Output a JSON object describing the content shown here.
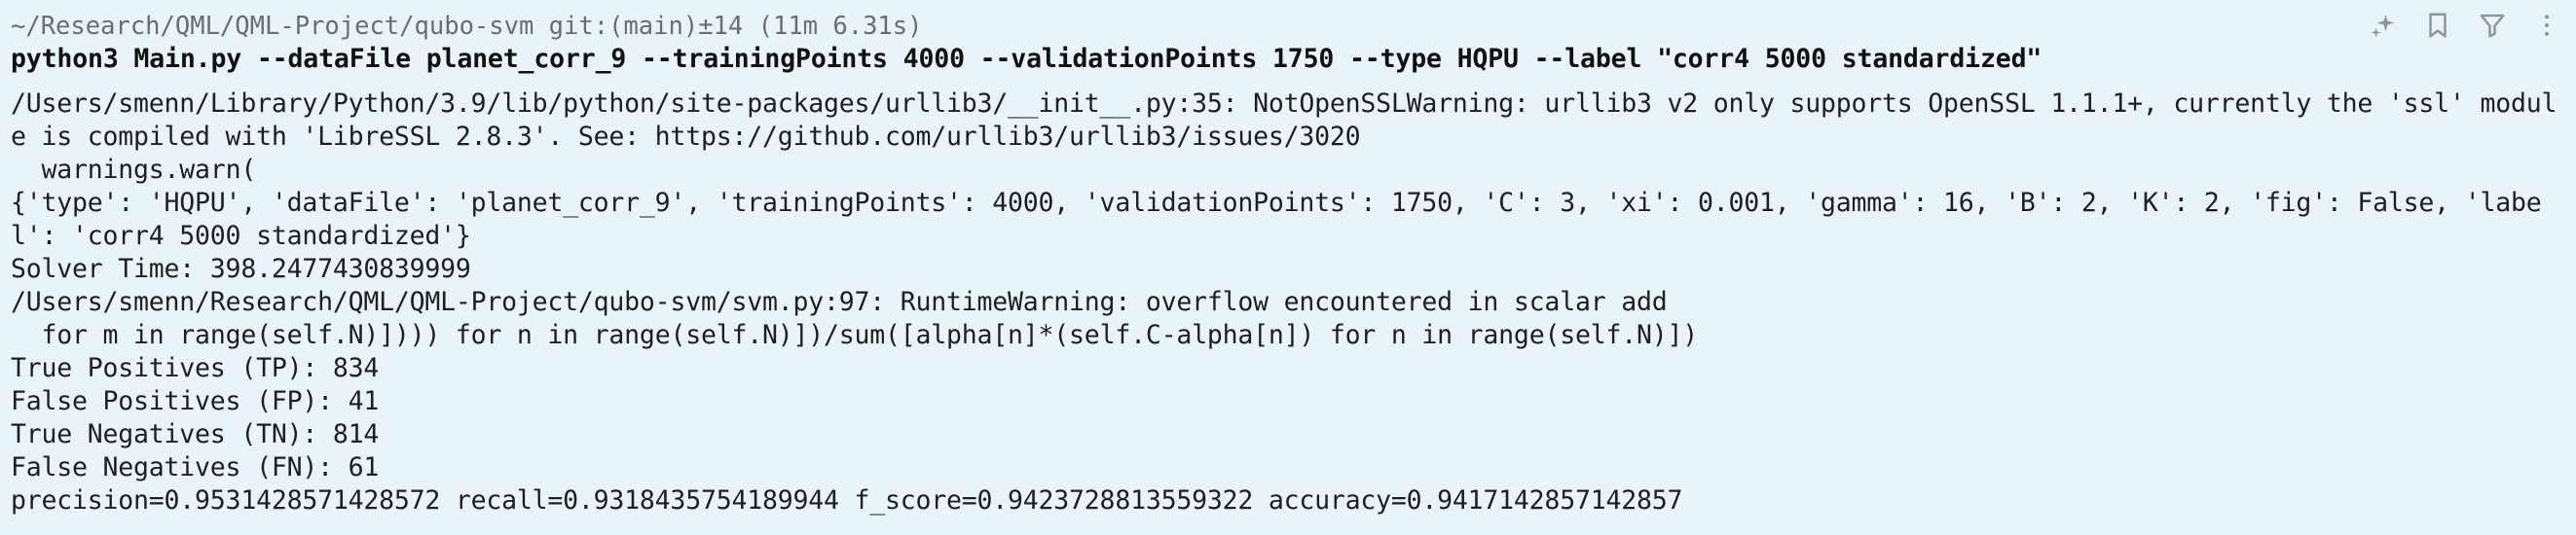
{
  "block": {
    "prompt": "~/Research/QML/QML-Project/qubo-svm git:(main)±14 (11m 6.31s)",
    "command": "python3 Main.py --dataFile planet_corr_9 --trainingPoints 4000 --validationPoints 1750 --type HQPU --label \"corr4 5000 standardized\"",
    "output": [
      "/Users/smenn/Library/Python/3.9/lib/python/site-packages/urllib3/__init__.py:35: NotOpenSSLWarning: urllib3 v2 only supports OpenSSL 1.1.1+, currently the 'ssl' module is compiled with 'LibreSSL 2.8.3'. See: https://github.com/urllib3/urllib3/issues/3020",
      "  warnings.warn(",
      "{'type': 'HQPU', 'dataFile': 'planet_corr_9', 'trainingPoints': 4000, 'validationPoints': 1750, 'C': 3, 'xi': 0.001, 'gamma': 16, 'B': 2, 'K': 2, 'fig': False, 'label': 'corr4 5000 standardized'}",
      "Solver Time: 398.2477430839999",
      "/Users/smenn/Research/QML/QML-Project/qubo-svm/svm.py:97: RuntimeWarning: overflow encountered in scalar add",
      "  for m in range(self.N)]))) for n in range(self.N)])/sum([alpha[n]*(self.C-alpha[n]) for n in range(self.N)])",
      "True Positives (TP): 834",
      "False Positives (FP): 41",
      "True Negatives (TN): 814",
      "False Negatives (FN): 61",
      "precision=0.9531428571428572 recall=0.9318435754189944 f_score=0.9423728813559322 accuracy=0.9417142857142857"
    ]
  },
  "toolbar": {
    "icons": [
      "ai-sparkle-icon",
      "bookmark-icon",
      "filter-icon",
      "more-vertical-icon"
    ]
  },
  "colors": {
    "background": "#e9f3fa",
    "prompt": "#6a6e72",
    "text": "#1f1f1f",
    "icon": "#8f959b"
  }
}
